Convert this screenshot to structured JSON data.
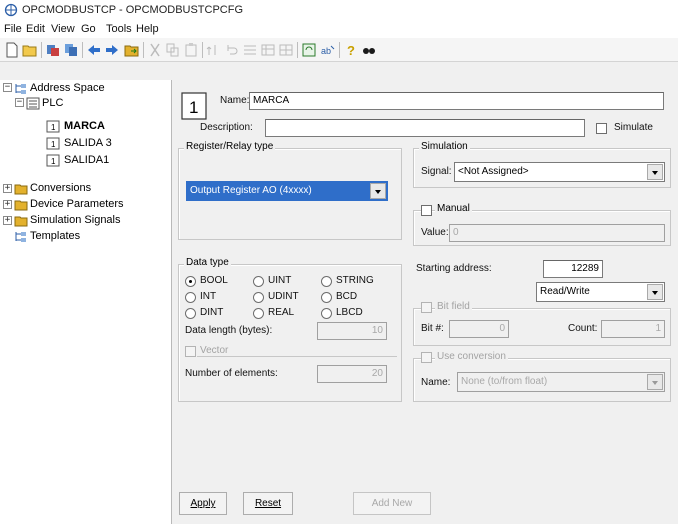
{
  "window": {
    "title": "OPCMODBUSTCP - OPCMODBUSTCPCFG",
    "app_icon": "network-icon"
  },
  "menu": [
    "File",
    "Edit",
    "View",
    "Go",
    "Tools",
    "Help"
  ],
  "toolbar": {
    "icons": [
      "new-icon",
      "open-icon",
      "cut-icon",
      "copy-icon",
      "back-icon",
      "forward-icon",
      "folder-icon",
      "cut-disabled-icon",
      "copy-disabled-icon",
      "paste-disabled-icon",
      "up-disabled-icon",
      "undo-disabled-icon",
      "list-icon",
      "details-icon",
      "grid-icon",
      "refresh-icon",
      "text-icon",
      "help-icon",
      "glasses-icon"
    ]
  },
  "tree": {
    "root": "Address Space",
    "plc": "PLC",
    "items": [
      "MARCA",
      "SALIDA 3",
      "SALIDA1"
    ],
    "selected": "MARCA",
    "others": [
      "Conversions",
      "Device Parameters",
      "Simulation Signals",
      "Templates"
    ]
  },
  "form": {
    "name_label": "Name:",
    "name_value": "MARCA",
    "description_label": "Description:",
    "description_value": "",
    "simulate_label": "Simulate",
    "register_group": "Register/Relay type",
    "register_value": "Output Register AO (4xxxx)",
    "simulation_group": "Simulation",
    "signal_label": "Signal:",
    "signal_value": "<Not Assigned>",
    "manual_label": "Manual",
    "value_label": "Value:",
    "value_value": "0",
    "datatype_group": "Data type",
    "datatypes": [
      [
        "BOOL",
        "UINT",
        "STRING"
      ],
      [
        "INT",
        "UDINT",
        "BCD"
      ],
      [
        "DINT",
        "REAL",
        "LBCD"
      ]
    ],
    "datatype_selected": "BOOL",
    "data_length_label": "Data length (bytes):",
    "data_length_value": "10",
    "vector_label": "Vector",
    "num_elements_label": "Number of elements:",
    "num_elements_value": "20",
    "starting_address_label": "Starting address:",
    "starting_address_value": "12289",
    "access_value": "Read/Write",
    "bitfield_label": "Bit field",
    "bit_label": "Bit #:",
    "bit_value": "0",
    "count_label": "Count:",
    "count_value": "1",
    "use_conversion_label": "Use conversion",
    "conv_name_label": "Name:",
    "conv_name_value": "None (to/from float)",
    "apply_label": "Apply",
    "reset_label": "Reset",
    "addnew_label": "Add New"
  }
}
